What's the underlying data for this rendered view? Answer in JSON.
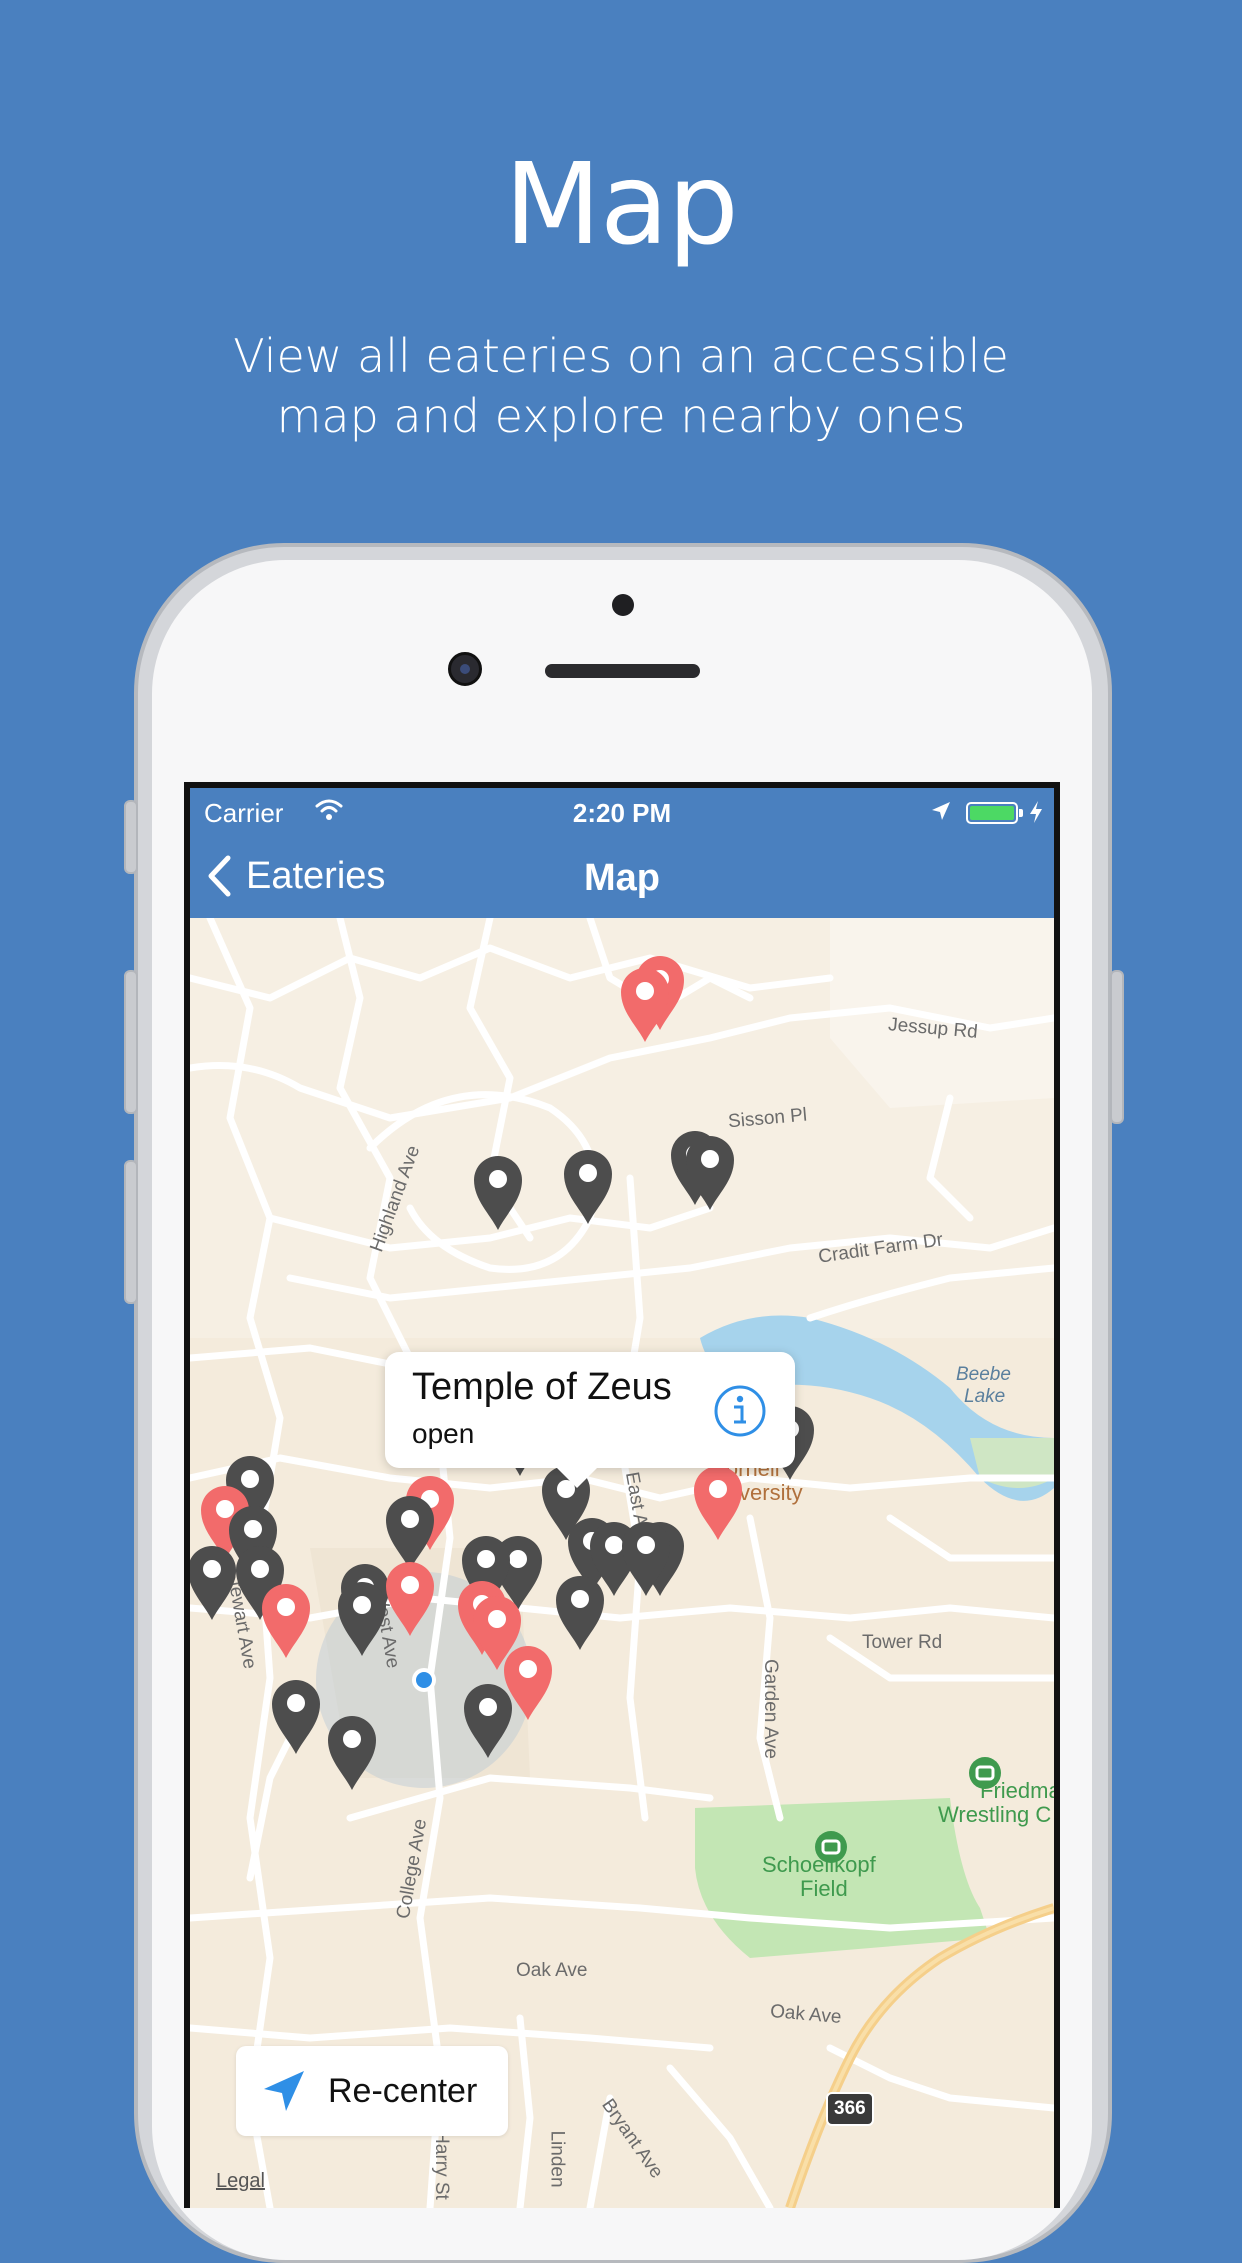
{
  "headline": {
    "title": "Map",
    "subtitle_line1": "View all eateries on an accessible",
    "subtitle_line2": "map and explore nearby ones"
  },
  "status_bar": {
    "carrier": "Carrier",
    "time": "2:20 PM",
    "battery_level": 1.0,
    "battery_color": "#4cd964"
  },
  "nav": {
    "back_label": "Eateries",
    "title": "Map"
  },
  "callout": {
    "title": "Temple of Zeus",
    "status": "open",
    "info_icon": "info-circle-icon"
  },
  "recenter": {
    "label": "Re-center",
    "icon": "location-arrow-icon"
  },
  "map": {
    "legal": "Legal",
    "labels": {
      "jessup": "Jessup Rd",
      "sisson": "Sisson Pl",
      "highland": "Highland Ave",
      "cradit": "Cradit Farm Dr",
      "beebe": "Beebe",
      "lake": "Lake",
      "cornell1": "Cornell",
      "cornell2": "University",
      "stewart": "Stewart Ave",
      "west": "West Ave",
      "east": "East Ave",
      "tower": "Tower Rd",
      "garden": "Garden Ave",
      "friedman1": "Friedman",
      "friedman2": "Wrestling C",
      "schoellkopf1": "Schoellkopf",
      "schoellkopf2": "Field",
      "college": "College Ave",
      "oak1": "Oak Ave",
      "oak2": "Oak Ave",
      "bryant": "Bryant Ave",
      "linden": "Linden",
      "harry": "Harry St",
      "route": "366"
    },
    "colors": {
      "open_pin": "#f26b6b",
      "closed_pin": "#4d4d4d",
      "water": "#a6d3ec",
      "park": "#c3e6b4",
      "accent": "#2f8fe6"
    }
  }
}
